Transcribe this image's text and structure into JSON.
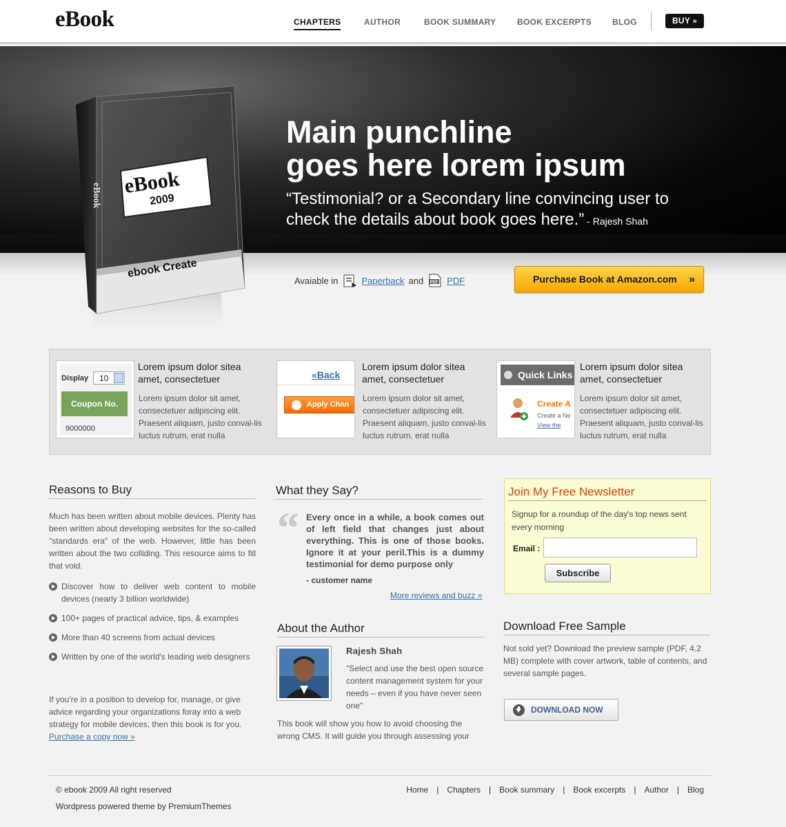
{
  "header": {
    "logo": "eBook",
    "nav": [
      "CHAPTERS",
      "AUTHOR",
      "BOOK SUMMARY",
      "BOOK EXCERPTS",
      "BLOG"
    ],
    "buy_label": "BUY",
    "buy_chevron": "»"
  },
  "hero": {
    "title_line1": "Main punchline",
    "title_line2": "goes here lorem ipsum",
    "subtitle": "“Testimonial? or a Secondary line convincing user to check the details about book goes here.”",
    "by": " - Rajesh Shah",
    "book": {
      "cover_logo": "eBook",
      "cover_year": "2009",
      "spine_text": "eBook",
      "band_text": "ebook Create"
    }
  },
  "availability": {
    "label": "Avaiable in",
    "paperback": "Paperback",
    "and": "and",
    "pdf": "PDF",
    "amazon_button": "Purchase Book at Amazon.com",
    "amazon_chevron": "»"
  },
  "features": [
    {
      "title": "Lorem ipsum dolor sitea amet, consectetuer",
      "text": "Lorem ipsum dolor sit amet, consectetuer adipiscing elit. Praesent aliquam,  justo conval-lis luctus rutrum, erat nulla",
      "thumb": {
        "display_label": "Display",
        "display_value": "10",
        "coupon_label": "Coupon No.",
        "coupon_value": "9000000"
      }
    },
    {
      "title": "Lorem ipsum dolor sitea amet, consectetuer",
      "text": "Lorem ipsum dolor sit amet, consectetuer adipiscing elit. Praesent aliquam,  justo conval-lis luctus rutrum, erat nulla",
      "thumb": {
        "back_label": "«Back",
        "apply_label": "Apply Chan"
      }
    },
    {
      "title": "Lorem ipsum dolor sitea amet, consectetuer",
      "text": "Lorem ipsum dolor sit amet, consectetuer adipiscing elit. Praesent aliquam,  justo conval-lis luctus rutrum, erat nulla",
      "thumb": {
        "quick_links": "Quick Links",
        "create_label": "Create A",
        "create_sub": "Create a Ne",
        "view_link": "View the"
      }
    }
  ],
  "reasons": {
    "heading": "Reasons to Buy",
    "intro": "Much has been written about mobile devices. Plenty has been written about developing websites for the so-called \"standards era\" of the web. However, little has been written about the two colliding. This resource aims to fill that void.",
    "bullets": [
      "Discover how to deliver web content to mobile devices (nearly 3 billion worldwide)",
      "100+ pages of practical advice, tips, & examples",
      "More than 40 screens from actual devices",
      "Written by one of the world's leading web designers"
    ],
    "outro": "If you're in a position to develop for, manage, or give advice regarding your organizations foray into a web strategy for mobile devices, then this book is for you.",
    "purchase_link": "Purchase a copy now »"
  },
  "testimonial": {
    "heading": "What they Say?",
    "quote": "Every once in a while, a book comes out of left field that changes just about everything. This is one of those books. Ignore it at your peril.This is a dummy testimonial for demo purpose only",
    "by": "- customer name",
    "more_link": "More reviews and buzz »"
  },
  "author": {
    "heading": "About the Author",
    "name": "Rajesh Shah",
    "quote": "\"Select and use the best open source content management system for your needs – even if you have never seen one\"",
    "text": "This book will show you how to avoid choosing the wrong CMS. It will guide you through assessing your"
  },
  "newsletter": {
    "title": "Join My Free Newsletter",
    "subtitle": "Signup for a roundup of the day's top news sent every morning",
    "email_label": "Email :",
    "email_value": "",
    "subscribe_label": "Subscribe"
  },
  "download": {
    "heading": "Download Free Sample",
    "text": "Not sold yet? Download the preview sample (PDF, 4.2 MB) complete with  cover artwork, table of contents, and several sample pages.",
    "button": "DOWNLOAD NOW"
  },
  "footer": {
    "copyright": "© ebook 2009  All right reserved",
    "powered": "Wordpress powered theme by PremiumThemes",
    "links": [
      "Home",
      "Chapters",
      "Book summary",
      "Book excerpts",
      "Author",
      "Blog"
    ],
    "separator": "|"
  },
  "colors": {
    "accent_orange": "#f7a800",
    "newsletter_title": "#d4430a",
    "link_blue": "#3a6ea8",
    "coupon_green": "#7aa35a"
  }
}
